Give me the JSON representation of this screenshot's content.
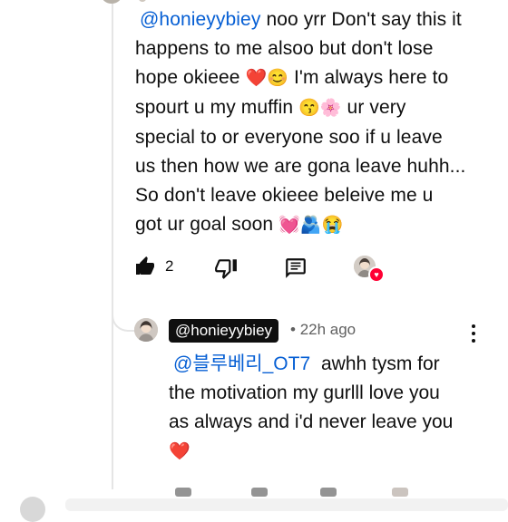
{
  "comment": {
    "mention": "@honieyybiey",
    "text_line1": "noo yrr Don't say this it",
    "text_line2": "happens to me alsoo but don't lose",
    "text_line3": "hope okieee",
    "text_line3_emoji": "❤️😊",
    "text_line3_rest": "I'm always here to",
    "text_line4": "spourt u my muffin",
    "text_line4_emoji": "😙🌸",
    "text_line4_rest": "ur very",
    "text_line5": "special to or everyone soo if u leave",
    "text_line6": "us then how we are gona leave huhh...",
    "text_line7": "So don't leave okieee beleive me u",
    "text_line8": "got ur goal soon",
    "text_line8_emoji": "💓🫂😭",
    "like_count": "2"
  },
  "reply": {
    "author": "@honieyybiey",
    "separator": "•",
    "time": "22h ago",
    "mention": "@블루베리_OT7",
    "text_line1": "awhh tysm for",
    "text_line2": "the motivation my gurlll love you",
    "text_line3": "as always and i'd never leave you",
    "text_line4_emoji": "❤️"
  },
  "icons": {
    "like": "thumbs-up-icon",
    "dislike": "thumbs-down-icon",
    "reply": "comment-reply-icon",
    "creator_heart": "creator-heart-icon",
    "menu": "more-vert-icon"
  },
  "colors": {
    "mention": "#065fd4",
    "heart_badge": "#ff0033",
    "author_chip_bg": "#0f0f0f"
  }
}
